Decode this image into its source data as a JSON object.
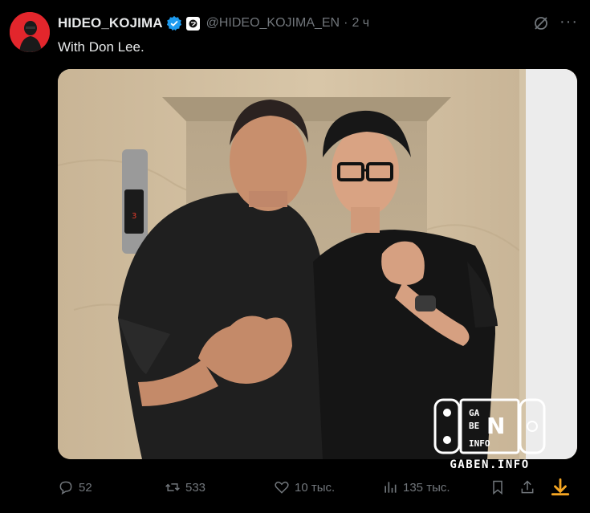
{
  "tweet": {
    "author_name": "HIDEO_KOJIMA",
    "handle": "@HIDEO_KOJIMA_EN",
    "separator": "·",
    "time": "2 ч",
    "text": "With Don Lee.",
    "more_icon": "more-horizontal-icon",
    "verified_color": "#1d9bf0"
  },
  "photo": {
    "elevator_floor": "3"
  },
  "actions": {
    "replies": "52",
    "reposts": "533",
    "likes": "10 тыс.",
    "views": "135 тыс."
  },
  "watermark": {
    "logo_letters": [
      "GA",
      "BE",
      "N",
      "INFO"
    ],
    "site": "GABEN.INFO"
  },
  "colors": {
    "bg": "#000000",
    "text": "#e7e9ea",
    "muted": "#71767b",
    "accent": "#1d9bf0",
    "download": "#f5a623"
  }
}
